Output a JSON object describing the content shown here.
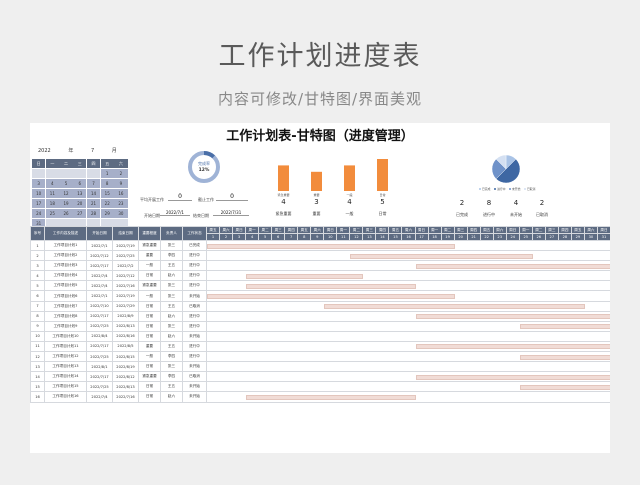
{
  "hero": {
    "title": "工作计划进度表",
    "subtitle": "内容可修改/甘特图/界面美观"
  },
  "sheet": {
    "title": "工作计划表-甘特图（进度管理）"
  },
  "calendar": {
    "year": "2022",
    "year_unit": "年",
    "month": "7",
    "month_unit": "月",
    "weekdays": [
      "日",
      "一",
      "二",
      "三",
      "四",
      "五",
      "六"
    ],
    "weeks": [
      [
        "",
        "",
        "",
        "",
        "",
        "1",
        "2"
      ],
      [
        "3",
        "4",
        "5",
        "6",
        "7",
        "8",
        "9"
      ],
      [
        "10",
        "11",
        "12",
        "13",
        "14",
        "15",
        "16"
      ],
      [
        "17",
        "18",
        "19",
        "20",
        "21",
        "22",
        "23"
      ],
      [
        "24",
        "25",
        "26",
        "27",
        "28",
        "29",
        "30"
      ],
      [
        "31",
        "",
        "",
        "",
        "",
        "",
        ""
      ]
    ]
  },
  "summary": {
    "plan_days_label": "平均开展工作",
    "plan_days_value": "0",
    "expired_label": "截止工作",
    "expired_value": "0",
    "start_label": "开始日期",
    "start_value": "2022/7/1",
    "end_label": "结束日期",
    "end_value": "2022/7/31"
  },
  "donut": {
    "label": "完成率",
    "value": "12%",
    "fraction": 0.12,
    "color": "#4a6fa8",
    "track": "#9fb3d6"
  },
  "priority_chart": {
    "categories": [
      "紧急重要",
      "重要",
      "一般",
      "日常"
    ],
    "values": [
      4,
      3,
      4,
      5
    ],
    "color": "#f28c3c",
    "ylim": [
      0,
      5
    ]
  },
  "status_chart": {
    "categories": [
      "已完成",
      "进行中",
      "未开始",
      "已取消"
    ],
    "values": [
      2,
      8,
      4,
      2
    ],
    "colors": [
      "#a9c3e6",
      "#3e67a3",
      "#6f92c9",
      "#d4e0f2"
    ]
  },
  "table": {
    "headers": [
      "序号",
      "工作内容及描述",
      "开始日期",
      "结束日期",
      "重要程度",
      "负责人",
      "工作状态"
    ],
    "week_row": [
      "周五",
      "周六",
      "周日",
      "周一",
      "周二",
      "周三",
      "周四",
      "周五",
      "周六",
      "周日",
      "周一",
      "周二",
      "周三",
      "周四",
      "周五",
      "周六",
      "周日",
      "周一",
      "周二",
      "周三",
      "周四",
      "周五",
      "周六",
      "周日",
      "周一",
      "周二",
      "周三",
      "周四",
      "周五",
      "周六",
      "周日"
    ],
    "day_row": [
      "1",
      "2",
      "3",
      "4",
      "5",
      "6",
      "7",
      "8",
      "9",
      "10",
      "11",
      "12",
      "13",
      "14",
      "15",
      "16",
      "17",
      "18",
      "19",
      "20",
      "21",
      "22",
      "23",
      "24",
      "25",
      "26",
      "27",
      "28",
      "29",
      "30",
      "31"
    ],
    "rows": [
      {
        "no": "1",
        "task": "工作项目计划1",
        "start": "2022/7/1",
        "end": "2022/7/19",
        "level": "紧急重要",
        "owner": "张三",
        "status": "已完成",
        "s": 1,
        "e": 19
      },
      {
        "no": "2",
        "task": "工作项目计划2",
        "start": "2022/7/12",
        "end": "2022/7/25",
        "level": "重要",
        "owner": "李四",
        "status": "进行中",
        "s": 12,
        "e": 25
      },
      {
        "no": "3",
        "task": "工作项目计划3",
        "start": "2022/7/17",
        "end": "2022/7/2",
        "level": "一般",
        "owner": "王五",
        "status": "进行中",
        "s": 17,
        "e": 31
      },
      {
        "no": "4",
        "task": "工作项目计划4",
        "start": "2022/7/4",
        "end": "2022/7/12",
        "level": "日常",
        "owner": "赵六",
        "status": "进行中",
        "s": 4,
        "e": 12
      },
      {
        "no": "5",
        "task": "工作项目计划5",
        "start": "2022/7/4",
        "end": "2022/7/16",
        "level": "紧急重要",
        "owner": "张三",
        "status": "进行中",
        "s": 4,
        "e": 16
      },
      {
        "no": "6",
        "task": "工作项目计划6",
        "start": "2022/7/1",
        "end": "2022/7/19",
        "level": "一般",
        "owner": "张三",
        "status": "未开始",
        "s": 1,
        "e": 19
      },
      {
        "no": "7",
        "task": "工作项目计划7",
        "start": "2022/7/10",
        "end": "2022/7/29",
        "level": "日常",
        "owner": "王五",
        "status": "已取消",
        "s": 10,
        "e": 29
      },
      {
        "no": "8",
        "task": "工作项目计划8",
        "start": "2022/7/17",
        "end": "2022/8/9",
        "level": "日常",
        "owner": "赵六",
        "status": "进行中",
        "s": 17,
        "e": 31
      },
      {
        "no": "9",
        "task": "工作项目计划9",
        "start": "2022/7/25",
        "end": "2022/8/13",
        "level": "日常",
        "owner": "张三",
        "status": "进行中",
        "s": 25,
        "e": 31
      },
      {
        "no": "10",
        "task": "工作项目计划10",
        "start": "2022/8/4",
        "end": "2022/8/16",
        "level": "日常",
        "owner": "赵六",
        "status": "未开始",
        "s": 0,
        "e": 0
      },
      {
        "no": "11",
        "task": "工作项目计划11",
        "start": "2022/7/17",
        "end": "2022/8/5",
        "level": "重要",
        "owner": "王五",
        "status": "进行中",
        "s": 17,
        "e": 31
      },
      {
        "no": "12",
        "task": "工作项目计划12",
        "start": "2022/7/25",
        "end": "2022/8/15",
        "level": "一般",
        "owner": "李四",
        "status": "进行中",
        "s": 25,
        "e": 31
      },
      {
        "no": "13",
        "task": "工作项目计划13",
        "start": "2022/8/1",
        "end": "2022/8/19",
        "level": "日常",
        "owner": "张三",
        "status": "未开始",
        "s": 0,
        "e": 0
      },
      {
        "no": "14",
        "task": "工作项目计划14",
        "start": "2022/7/17",
        "end": "2022/8/12",
        "level": "紧急重要",
        "owner": "李四",
        "status": "已取消",
        "s": 17,
        "e": 31
      },
      {
        "no": "15",
        "task": "工作项目计划15",
        "start": "2022/7/25",
        "end": "2022/8/13",
        "level": "日常",
        "owner": "王五",
        "status": "未开始",
        "s": 25,
        "e": 31
      },
      {
        "no": "16",
        "task": "工作项目计划16",
        "start": "2022/7/4",
        "end": "2022/7/16",
        "level": "日常",
        "owner": "赵六",
        "status": "未开始",
        "s": 4,
        "e": 16
      }
    ]
  }
}
